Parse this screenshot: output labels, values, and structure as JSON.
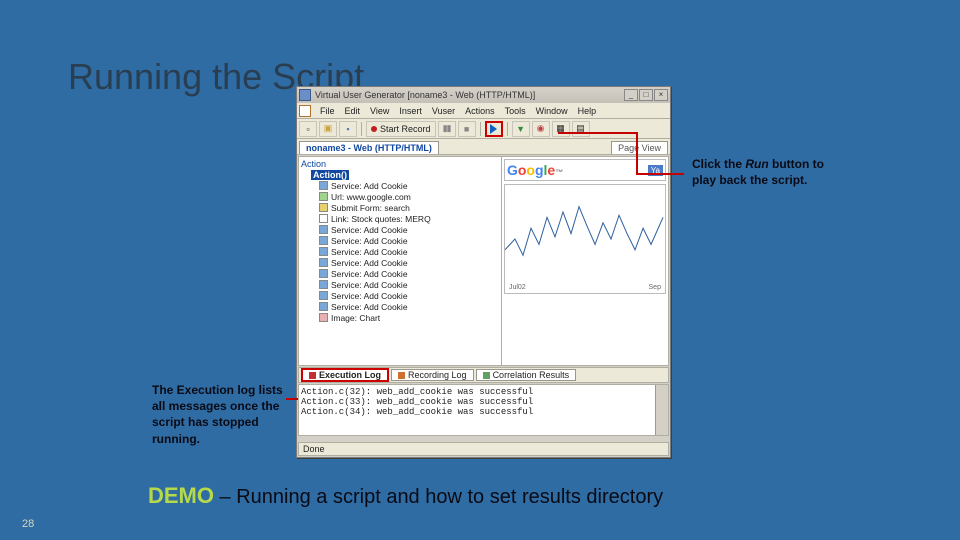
{
  "slide": {
    "title": "Running the Script",
    "page_number": "28"
  },
  "callouts": {
    "run_pre": "Click the ",
    "run_em": "Run",
    "run_post": " button to play back the script.",
    "log": "The Execution log lists all messages once the script has stopped running."
  },
  "demo": {
    "label": "DEMO",
    "text": " – Running a script and how to set results directory"
  },
  "app": {
    "title": "Virtual User Generator  [noname3 - Web (HTTP/HTML)]",
    "winbtns": {
      "min": "_",
      "max": "□",
      "close": "×"
    },
    "menu": [
      "File",
      "Edit",
      "View",
      "Insert",
      "Vuser",
      "Actions",
      "Tools",
      "Window",
      "Help"
    ],
    "toolbar": {
      "start_record": "Start Record"
    },
    "doc_tab": "noname3 - Web (HTTP/HTML)",
    "right_tabs": [
      "Page View",
      "...",
      "..."
    ],
    "tree": {
      "root": "Action",
      "action_label": "Action()",
      "items": [
        "Service: Add Cookie",
        "Url: www.google.com",
        "Submit Form: search",
        "Link: Stock quotes: MERQ",
        "Service: Add Cookie",
        "Service: Add Cookie",
        "Service: Add Cookie",
        "Service: Add Cookie",
        "Service: Add Cookie",
        "Service: Add Cookie",
        "Service: Add Cookie",
        "Service: Add Cookie",
        "Image: Chart"
      ]
    },
    "preview": {
      "google": "Google",
      "ya": "Ya",
      "axis_left": "Jul02",
      "axis_right": "Sep"
    },
    "bottom_tabs": {
      "exec": "Execution Log",
      "rec": "Recording Log",
      "corr": "Correlation Results"
    },
    "log_lines": [
      "Action.c(32): web_add_cookie was successful",
      "Action.c(33): web_add_cookie was successful",
      "Action.c(34): web_add_cookie was successful"
    ],
    "status": "Done"
  }
}
